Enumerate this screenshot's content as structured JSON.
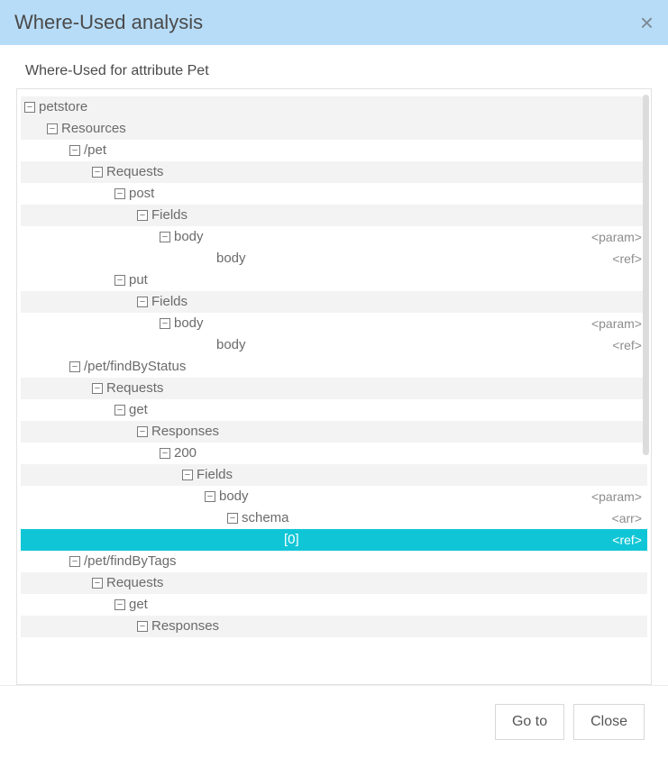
{
  "header": {
    "title": "Where-Used analysis"
  },
  "subtitle": "Where-Used for attribute Pet",
  "badges": {
    "param": "<param>",
    "ref": "<ref>",
    "arr": "<arr>"
  },
  "tree": [
    {
      "label": "petstore",
      "indent": 0,
      "toggle": true,
      "shaded": true
    },
    {
      "label": "Resources",
      "indent": 1,
      "toggle": true,
      "shaded": true
    },
    {
      "label": "/pet",
      "indent": 2,
      "toggle": true,
      "shaded": false
    },
    {
      "label": "Requests",
      "indent": 3,
      "toggle": true,
      "shaded": true
    },
    {
      "label": "post",
      "indent": 4,
      "toggle": true,
      "shaded": false
    },
    {
      "label": "Fields",
      "indent": 5,
      "toggle": true,
      "shaded": true
    },
    {
      "label": "body",
      "indent": 6,
      "toggle": true,
      "shaded": false,
      "badge": "param"
    },
    {
      "label": "body",
      "indent": 7,
      "toggle": false,
      "shaded": false,
      "badge": "ref"
    },
    {
      "label": "put",
      "indent": 4,
      "toggle": true,
      "shaded": false
    },
    {
      "label": "Fields",
      "indent": 5,
      "toggle": true,
      "shaded": true
    },
    {
      "label": "body",
      "indent": 6,
      "toggle": true,
      "shaded": false,
      "badge": "param"
    },
    {
      "label": "body",
      "indent": 7,
      "toggle": false,
      "shaded": false,
      "badge": "ref"
    },
    {
      "label": "/pet/findByStatus",
      "indent": 2,
      "toggle": true,
      "shaded": false
    },
    {
      "label": "Requests",
      "indent": 3,
      "toggle": true,
      "shaded": true
    },
    {
      "label": "get",
      "indent": 4,
      "toggle": true,
      "shaded": false
    },
    {
      "label": "Responses",
      "indent": 5,
      "toggle": true,
      "shaded": true
    },
    {
      "label": "200",
      "indent": 6,
      "toggle": true,
      "shaded": false
    },
    {
      "label": "Fields",
      "indent": 7,
      "toggle": true,
      "shaded": true
    },
    {
      "label": "body",
      "indent": 8,
      "toggle": true,
      "shaded": false,
      "badge": "param"
    },
    {
      "label": "schema",
      "indent": 9,
      "toggle": true,
      "shaded": false,
      "badge": "arr"
    },
    {
      "label": "[0]",
      "indent": 10,
      "toggle": false,
      "shaded": false,
      "badge": "ref",
      "selected": true
    },
    {
      "label": "/pet/findByTags",
      "indent": 2,
      "toggle": true,
      "shaded": false
    },
    {
      "label": "Requests",
      "indent": 3,
      "toggle": true,
      "shaded": true
    },
    {
      "label": "get",
      "indent": 4,
      "toggle": true,
      "shaded": false
    },
    {
      "label": "Responses",
      "indent": 5,
      "toggle": true,
      "shaded": true
    }
  ],
  "footer": {
    "goto": "Go to",
    "close": "Close"
  }
}
